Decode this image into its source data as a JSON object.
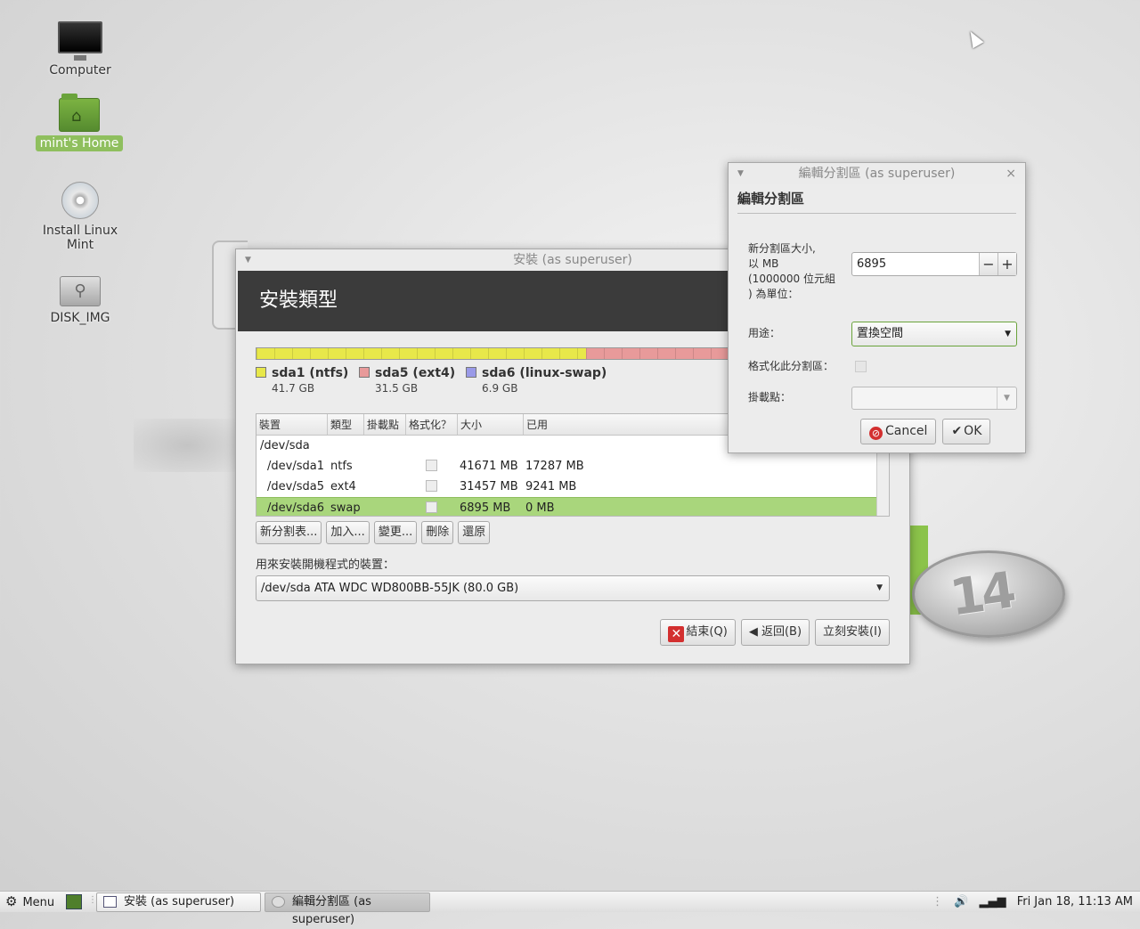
{
  "desktop": {
    "icons": [
      {
        "label": "Computer",
        "icon": "computer-icon"
      },
      {
        "label": "mint's Home",
        "icon": "home-folder-icon",
        "selected": true
      },
      {
        "label": "Install Linux Mint",
        "icon": "disc-icon"
      },
      {
        "label": "DISK_IMG",
        "icon": "usb-drive-icon"
      }
    ],
    "badge_text": "14"
  },
  "installer": {
    "title": "安裝 (as superuser)",
    "header": "安裝類型",
    "partitions_bar": [
      {
        "name": "sda1",
        "fraction": 0.521,
        "color": "#e8e84a"
      },
      {
        "name": "sda5",
        "fraction": 0.394,
        "color": "#e89a9a"
      },
      {
        "name": "sda6",
        "fraction": 0.085,
        "color": "#9a9ae8"
      }
    ],
    "legend": [
      {
        "name": "sda1 (ntfs)",
        "size": "41.7 GB",
        "color": "#e8e84a"
      },
      {
        "name": "sda5 (ext4)",
        "size": "31.5 GB",
        "color": "#e89a9a"
      },
      {
        "name": "sda6 (linux-swap)",
        "size": "6.9 GB",
        "color": "#9a9ae8"
      }
    ],
    "table": {
      "headers": [
        "裝置",
        "類型",
        "掛載點",
        "格式化？",
        "大小",
        "已用"
      ],
      "disk": "/dev/sda",
      "rows": [
        {
          "device": "/dev/sda1",
          "type": "ntfs",
          "mount": "",
          "size": "41671 MB",
          "used": "17287 MB"
        },
        {
          "device": "/dev/sda5",
          "type": "ext4",
          "mount": "",
          "size": "31457 MB",
          "used": "9241 MB"
        },
        {
          "device": "/dev/sda6",
          "type": "swap",
          "mount": "",
          "size": "6895 MB",
          "used": "0 MB",
          "selected": true
        }
      ]
    },
    "buttons": {
      "new_table": "新分割表...",
      "add": "加入...",
      "change": "變更...",
      "delete": "刪除",
      "revert": "還原"
    },
    "boot_label": "用來安裝開機程式的裝置：",
    "boot_device": "/dev/sda   ATA WDC WD800BB-55JK (80.0 GB)",
    "quit": "結束(Q)",
    "back": "返回(B)",
    "install_now": "立刻安裝(I)"
  },
  "edit_dialog": {
    "title": "編輯分割區 (as superuser)",
    "heading": "編輯分割區",
    "size_label_lines": [
      "新分割區大小,",
      "以 MB",
      "(1000000 位元組",
      ") 為單位："
    ],
    "size_value": "6895",
    "use_label": "用途：",
    "use_value": "置換空間",
    "format_label": "格式化此分割區：",
    "mount_label": "掛載點：",
    "mount_value": "",
    "cancel": "Cancel",
    "ok": "OK"
  },
  "panel": {
    "menu": "Menu",
    "tasks": [
      {
        "label": "安裝 (as superuser)",
        "active": false
      },
      {
        "label": "編輯分割區 (as superuser)",
        "active": true
      }
    ],
    "clock": "Fri Jan 18, 11:13 AM"
  }
}
